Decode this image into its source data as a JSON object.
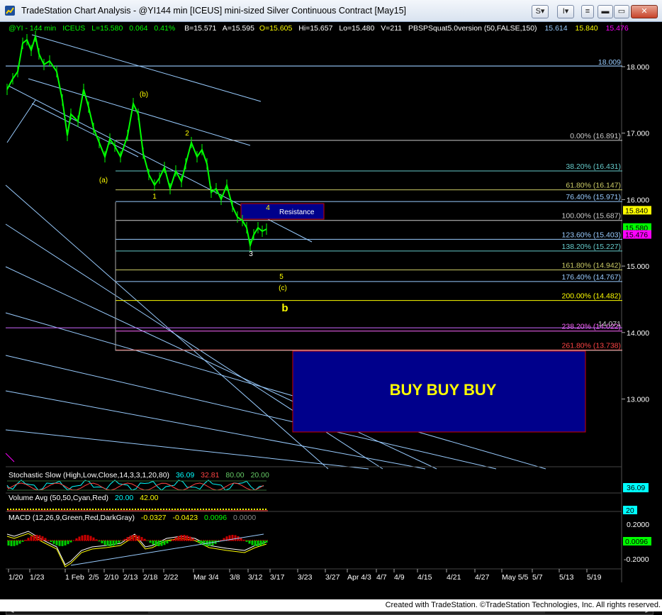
{
  "window": {
    "title": "TradeStation Chart Analysis - @YI144 min [ICEUS] mini-sized Silver Continuous Contract [May15]",
    "btn_s": "S",
    "btn_i": "I"
  },
  "legend": {
    "symbol": "@YI - 144 min",
    "exchange": "ICEUS",
    "last": "L=15.580",
    "change": "0.064",
    "pct": "0.41%",
    "bid": "B=15.571",
    "ask": "A=15.595",
    "open": "O=15.605",
    "high": "Hi=15.657",
    "low": "Lo=15.480",
    "vol": "V=211",
    "indicator": "PBSPSquat5.0version (50,FALSE,150)",
    "val1": "15.614",
    "val2": "15.840",
    "val3": "15.476"
  },
  "colors": {
    "price": "#00ff00",
    "cyan": "#99ccff",
    "yellow": "#ffff00",
    "fib": "#cccccc",
    "box_fill": "#00008b",
    "box_border": "#cc0000",
    "magenta": "#ff00ff"
  },
  "fib_levels": [
    {
      "label": "18.009",
      "price": 18.009,
      "color": "#99ccff",
      "kind": "line"
    },
    {
      "label": "0.00% (16.891)",
      "price": 16.891,
      "color": "#cccccc"
    },
    {
      "label": "38.20% (16.431)",
      "price": 16.431,
      "color": "#66cccc"
    },
    {
      "label": "61.80% (16.147)",
      "price": 16.147,
      "color": "#cccc66"
    },
    {
      "label": "76.40% (15.971)",
      "price": 15.971,
      "color": "#99ccff"
    },
    {
      "label": "100.00% (15.687)",
      "price": 15.687,
      "color": "#cccccc"
    },
    {
      "label": "123.60% (15.403)",
      "price": 15.403,
      "color": "#99ccff"
    },
    {
      "label": "138.20% (15.227)",
      "price": 15.227,
      "color": "#66cccc"
    },
    {
      "label": "161.80% (14.942)",
      "price": 14.942,
      "color": "#cccc66"
    },
    {
      "label": "176.40% (14.767)",
      "price": 14.767,
      "color": "#99ccff"
    },
    {
      "label": "200.00% (14.482)",
      "price": 14.482,
      "color": "#ffff00"
    },
    {
      "label": "238.20% (14.022)",
      "price": 14.022,
      "color": "#ff66ff"
    },
    {
      "label": "261.80% (13.738)",
      "price": 13.738,
      "color": "#ff4444"
    }
  ],
  "price_axis": {
    "ticks": [
      {
        "label": "18.000",
        "value": 18.0
      },
      {
        "label": "17.000",
        "value": 17.0
      },
      {
        "label": "16.000",
        "value": 16.0
      },
      {
        "label": "15.000",
        "value": 15.0
      },
      {
        "label": "14.000",
        "value": 14.0
      },
      {
        "label": "13.000",
        "value": 13.0
      }
    ],
    "markers": [
      {
        "label": "15.840",
        "value": 15.84,
        "bg": "#ffff00",
        "fg": "#000000"
      },
      {
        "label": "15.580",
        "value": 15.58,
        "bg": "#00ff00",
        "fg": "#000000"
      },
      {
        "label": "15.476",
        "value": 15.476,
        "bg": "#ff00ff",
        "fg": "#000000"
      }
    ],
    "line_label": "14.071",
    "line_value": 14.071
  },
  "wave_labels": [
    {
      "text": "(b)",
      "color": "#ffff00"
    },
    {
      "text": "2",
      "color": "#ffff00"
    },
    {
      "text": "(a)",
      "color": "#ffff00"
    },
    {
      "text": "1",
      "color": "#ffff00"
    },
    {
      "text": "4",
      "color": "#ffff00"
    },
    {
      "text": "3",
      "color": "#ffffff"
    },
    {
      "text": "5",
      "color": "#ffff00"
    },
    {
      "text": "(c)",
      "color": "#ffff00"
    },
    {
      "text": "b",
      "color": "#ffff00"
    }
  ],
  "boxes": {
    "resistance": "Resistance",
    "buy": "BUY BUY BUY"
  },
  "indicators": {
    "stoch": {
      "name": "Stochastic Slow (High,Low,Close,14,3,3,1,20,80)",
      "v1": "36.09",
      "v2": "32.81",
      "v3": "80.00",
      "v4": "20.00",
      "axis": "36.09"
    },
    "volume": {
      "name": "Volume Avg (50,50,Cyan,Red)",
      "v1": "20.00",
      "v2": "42.00",
      "axis": "20"
    },
    "macd": {
      "name": "MACD (12,26,9,Green,Red,DarkGray)",
      "v1": "-0.0327",
      "v2": "-0.0423",
      "v3": "0.0096",
      "v4": "0.0000",
      "ticks": [
        "0.2000",
        "0.0096",
        "-0.2000"
      ]
    }
  },
  "time_axis": [
    "1/20",
    "1/23",
    "1 Feb",
    "2/5",
    "2/10",
    "2/13",
    "2/18",
    "2/22",
    "Mar 3/4",
    "3/8",
    "3/12",
    "3/17",
    "3/23",
    "3/27",
    "Apr 4/3",
    "4/7",
    "4/9",
    "4/15",
    "4/21",
    "4/27",
    "May 5/5",
    "5/7",
    "5/13",
    "5/19"
  ],
  "footer": "Created with TradeStation. ©TradeStation Technologies, Inc. All rights reserved."
}
